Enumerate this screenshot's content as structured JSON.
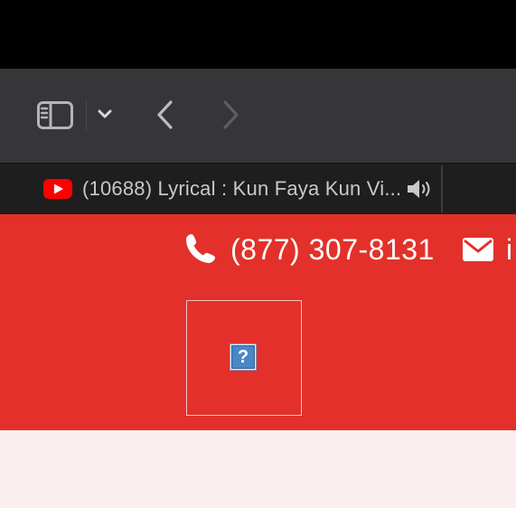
{
  "toolbar": {
    "sidebar_icon": "sidebar-icon",
    "dropdown_icon": "chevron-down-icon",
    "back_icon": "chevron-left-icon",
    "forward_icon": "chevron-right-icon"
  },
  "tab": {
    "favicon": "youtube-icon",
    "title": "(10688) Lyrical : Kun Faya Kun Vi...",
    "audio_icon": "speaker-icon"
  },
  "contact": {
    "phone_icon": "phone-icon",
    "phone": "(877) 307-8131",
    "mail_icon": "envelope-icon",
    "email_visible": "i"
  },
  "logo": {
    "icon": "broken-image-icon",
    "glyph": "?"
  },
  "colors": {
    "toolbar_bg": "#363638",
    "tabbar_bg": "#1e1e1f",
    "brand_red": "#e3302a",
    "youtube_red": "#ff0000",
    "content_bg": "#fbeeee"
  }
}
